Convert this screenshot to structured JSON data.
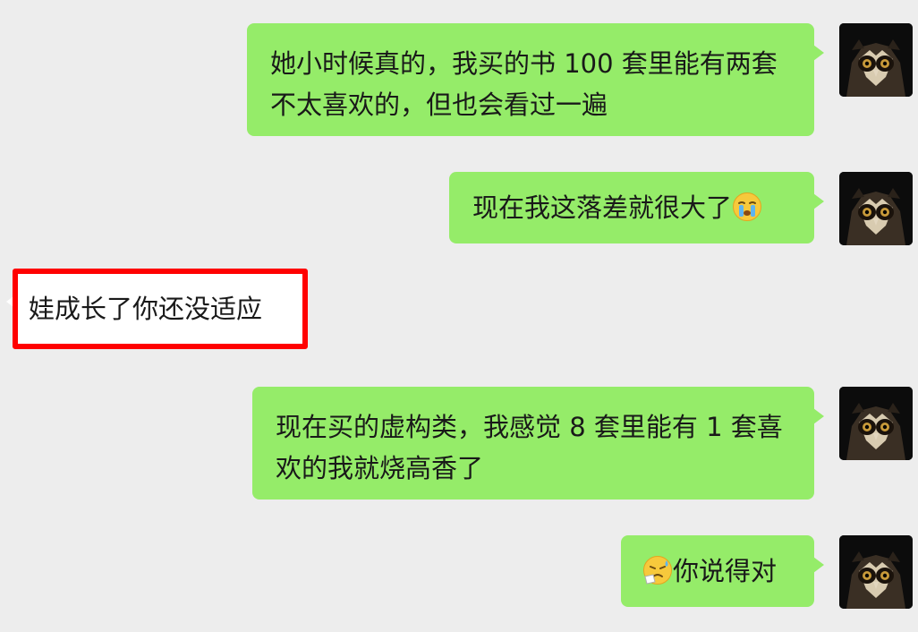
{
  "messages": [
    {
      "direction": "outgoing",
      "text": "她小时候真的，我买的书 100 套里能有两套不太喜欢的，但也会看过一遍",
      "avatar_icon": "owl-avatar-icon"
    },
    {
      "direction": "outgoing",
      "text": "现在我这落差就很大了",
      "emoji_after": "crying-emoji-icon",
      "avatar_icon": "owl-avatar-icon"
    },
    {
      "direction": "incoming",
      "text": "娃成长了你还没适应",
      "highlighted": true,
      "highlight_color": "#ff0000"
    },
    {
      "direction": "outgoing",
      "text": "现在买的虚构类，我感觉 8 套里能有 1 套喜欢的我就烧高香了",
      "avatar_icon": "owl-avatar-icon"
    },
    {
      "direction": "outgoing",
      "text": "你说得对",
      "emoji_before": "sweating-facepalm-emoji-icon",
      "avatar_icon": "owl-avatar-icon"
    }
  ],
  "colors": {
    "background": "#ededed",
    "outgoing_bubble": "#95ec69",
    "incoming_bubble": "#ffffff",
    "text": "#191919",
    "highlight_border": "#ff0000"
  }
}
